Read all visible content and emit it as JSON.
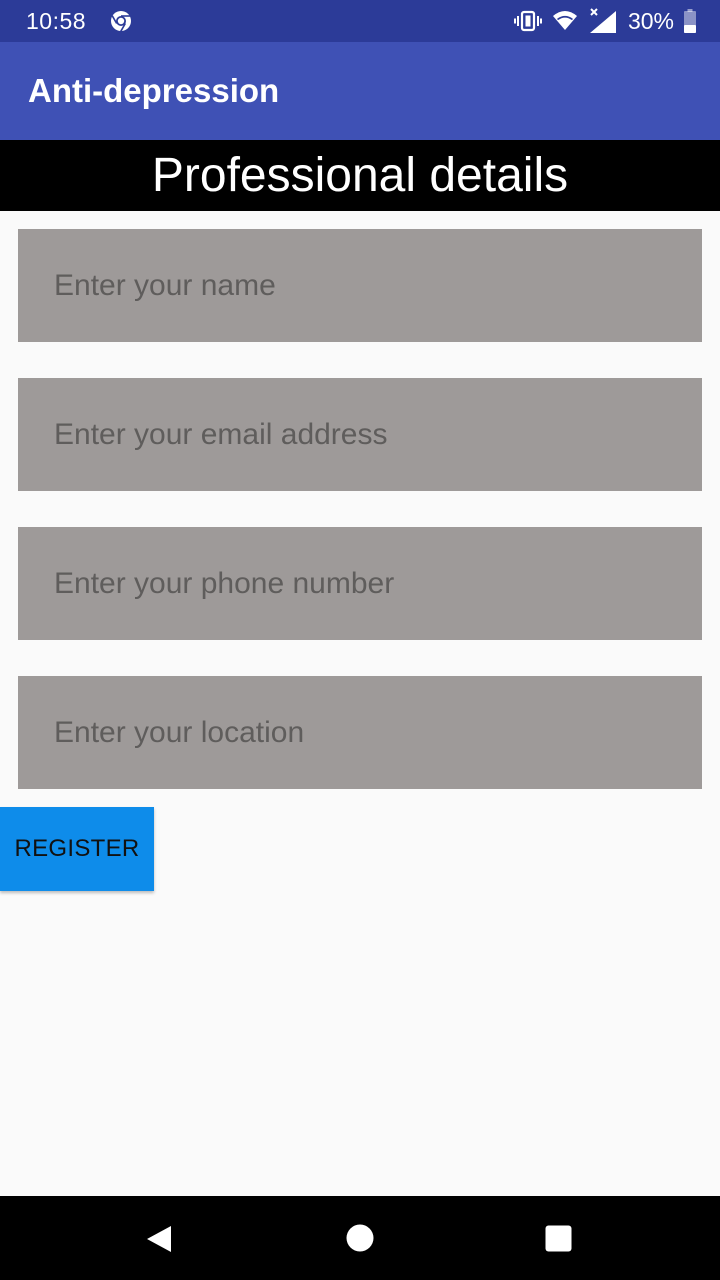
{
  "status_bar": {
    "time": "10:58",
    "battery": "30%",
    "icons": [
      "chrome-icon",
      "vibrate-icon",
      "wifi-icon",
      "cell-signal-icon",
      "battery-icon"
    ]
  },
  "app_bar": {
    "title": "Anti-depression"
  },
  "section": {
    "title": "Professional details"
  },
  "form": {
    "name_placeholder": "Enter your name",
    "email_placeholder": "Enter your email address",
    "phone_placeholder": "Enter your phone number",
    "location_placeholder": "Enter your location",
    "register_label": "REGISTER"
  },
  "nav_bar": {
    "icons": [
      "back-icon",
      "home-icon",
      "recents-icon"
    ]
  },
  "colors": {
    "status_bar": "#2c3b98",
    "app_bar": "#3f51b5",
    "section_header": "#000000",
    "input_bg": "#9e9a99",
    "button": "#0e8cea",
    "background": "#fafafa"
  }
}
